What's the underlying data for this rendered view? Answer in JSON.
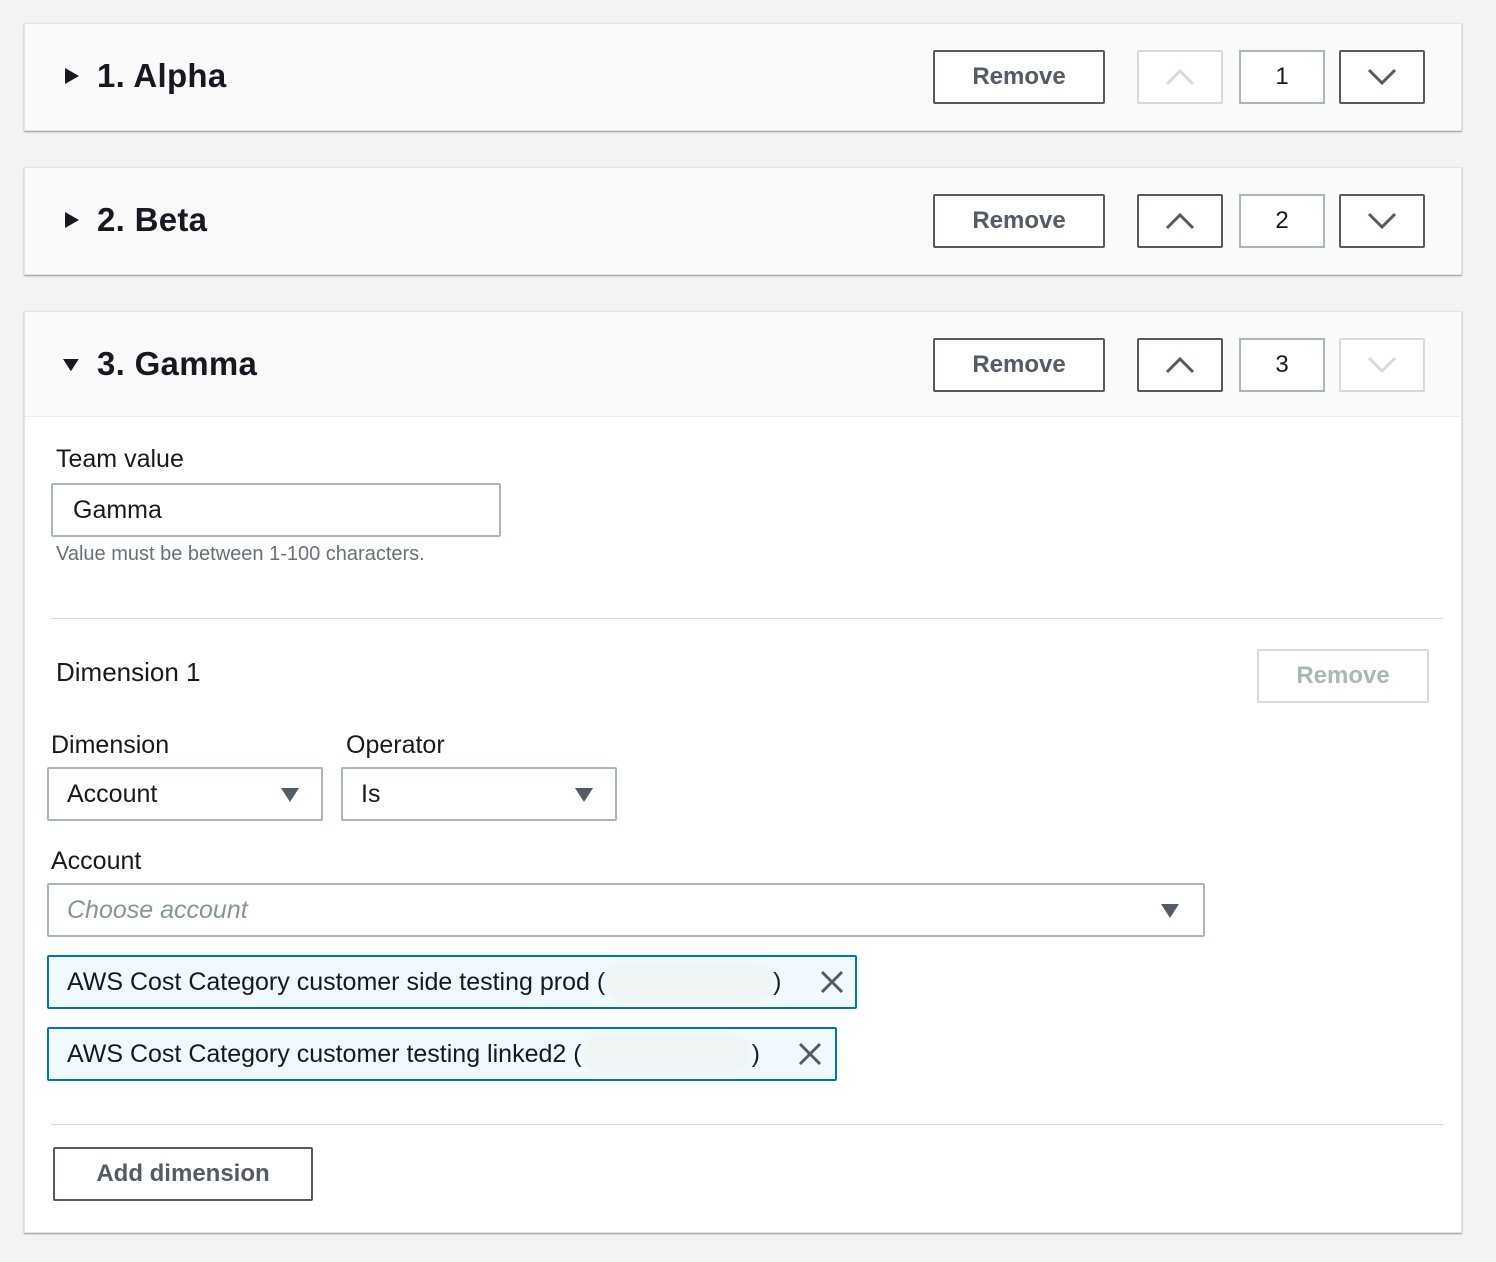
{
  "panels": [
    {
      "title": "1. Alpha",
      "remove_label": "Remove",
      "order": "1",
      "expanded": false,
      "up_enabled": false,
      "down_enabled": true
    },
    {
      "title": "2. Beta",
      "remove_label": "Remove",
      "order": "2",
      "expanded": false,
      "up_enabled": true,
      "down_enabled": true
    },
    {
      "title": "3. Gamma",
      "remove_label": "Remove",
      "order": "3",
      "expanded": true,
      "up_enabled": true,
      "down_enabled": false
    }
  ],
  "gamma": {
    "team_value_label": "Team value",
    "team_value": "Gamma",
    "team_value_hint": "Value must be between 1-100 characters.",
    "dimension_heading": "Dimension 1",
    "dimension_remove_label": "Remove",
    "dimension_label": "Dimension",
    "dimension_value": "Account",
    "operator_label": "Operator",
    "operator_value": "Is",
    "account_label": "Account",
    "account_placeholder": "Choose account",
    "tokens": [
      {
        "prefix": "AWS Cost Category customer side testing prod (",
        "suffix": ")"
      },
      {
        "prefix": "AWS Cost Category customer testing linked2 (",
        "suffix": ")"
      }
    ],
    "add_dimension_label": "Add dimension"
  },
  "colors": {
    "page_bg": "#f2f3f3",
    "panel_header_bg": "#fafafa",
    "button_border": "#545b64",
    "disabled": "#d5dbdb",
    "token_border": "#0073bb",
    "token_bg": "#f1faff"
  },
  "icons": {
    "collapsed": "caret-right-icon",
    "expanded": "caret-down-icon",
    "up": "chevron-up-icon",
    "down": "chevron-down-icon",
    "dismiss": "close-icon",
    "select": "dropdown-caret-icon"
  }
}
